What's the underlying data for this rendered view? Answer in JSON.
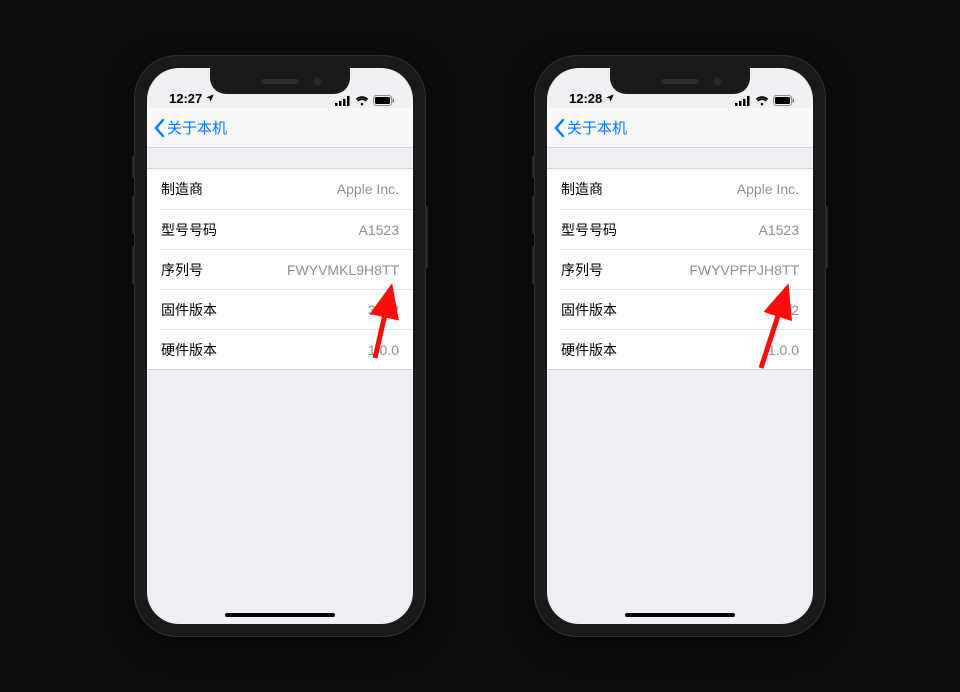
{
  "phones": [
    {
      "status": {
        "time": "12:27",
        "location_arrow": true
      },
      "nav": {
        "back_label": "关于本机"
      },
      "rows": [
        {
          "label": "制造商",
          "value": "Apple Inc."
        },
        {
          "label": "型号号码",
          "value": "A1523"
        },
        {
          "label": "序列号",
          "value": "FWYVMKL9H8TT"
        },
        {
          "label": "固件版本",
          "value": "3.7.2"
        },
        {
          "label": "硬件版本",
          "value": "1.0.0"
        }
      ]
    },
    {
      "status": {
        "time": "12:28",
        "location_arrow": true
      },
      "nav": {
        "back_label": "关于本机"
      },
      "rows": [
        {
          "label": "制造商",
          "value": "Apple Inc."
        },
        {
          "label": "型号号码",
          "value": "A1523"
        },
        {
          "label": "序列号",
          "value": "FWYVPFPJH8TT"
        },
        {
          "label": "固件版本",
          "value": "6.3.2"
        },
        {
          "label": "硬件版本",
          "value": "1.0.0"
        }
      ]
    }
  ],
  "accent_blue": "#007aff",
  "arrow_color": "#ff0b0b"
}
